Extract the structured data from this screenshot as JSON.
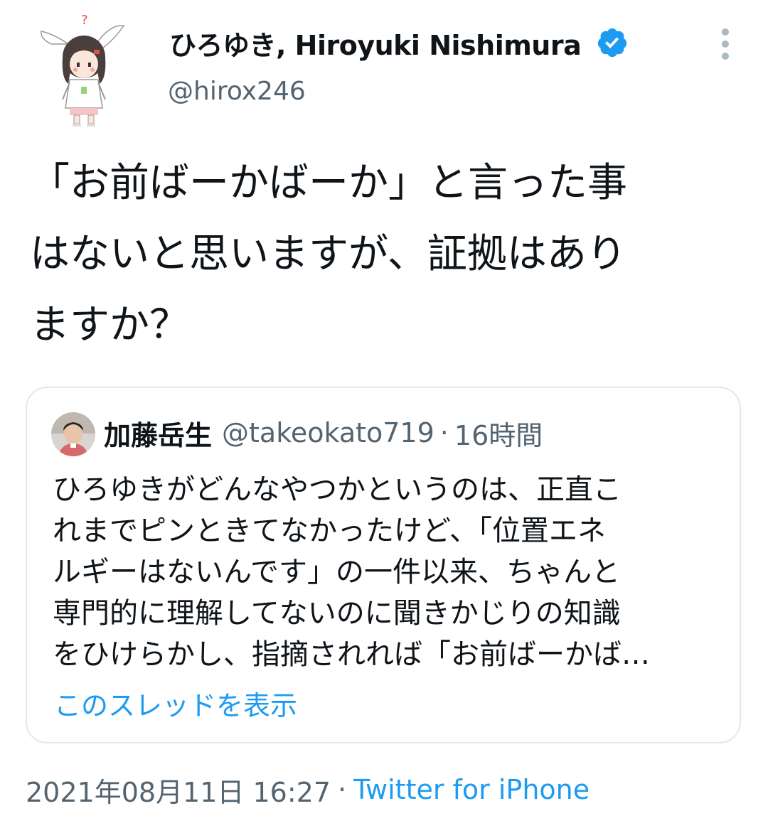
{
  "author": {
    "display_name": "ひろゆき, Hiroyuki Nishimura",
    "handle": "@hirox246",
    "verified": true
  },
  "tweet": {
    "lines": [
      "「お前ばーかばーか」と言った事",
      "はないと思いますが、証拠はあり",
      "ますか？"
    ]
  },
  "quoted_tweet": {
    "author_name": "加藤岳生",
    "author_handle": "@takeokato719",
    "separator": "·",
    "time": "16時間",
    "lines": [
      "ひろゆきがどんなやつかというのは、正直こ",
      "れまでピンときてなかったけど、「位置エネ",
      "ルギーはないんです」の一件以来、ちゃんと",
      "専門的に理解してないのに聞きかじりの知識",
      "をひけらかし、指摘されれば「お前ばーかば…"
    ],
    "show_thread": "このスレッドを表示"
  },
  "footer": {
    "timestamp": "2021年08月11日 16:27",
    "separator": "·",
    "source": "Twitter for iPhone"
  },
  "colors": {
    "link": "#1d9bf0",
    "secondary_text": "#536471",
    "verified_badge": "#1d9bf0",
    "border": "#e1e8ed"
  },
  "icons": {
    "verified": "verified-badge-icon",
    "more": "more-vertical-icon"
  }
}
